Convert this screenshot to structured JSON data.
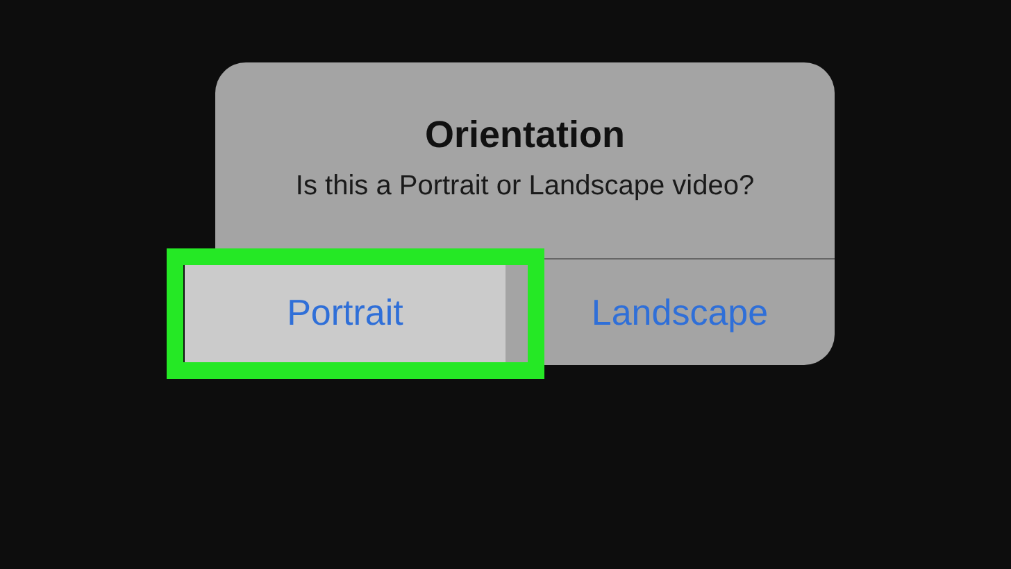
{
  "dialog": {
    "title": "Orientation",
    "message": "Is this a Portrait or Landscape video?",
    "buttons": [
      {
        "label": "Portrait",
        "selected": true,
        "highlighted": true
      },
      {
        "label": "Landscape",
        "selected": false,
        "highlighted": false
      }
    ]
  }
}
